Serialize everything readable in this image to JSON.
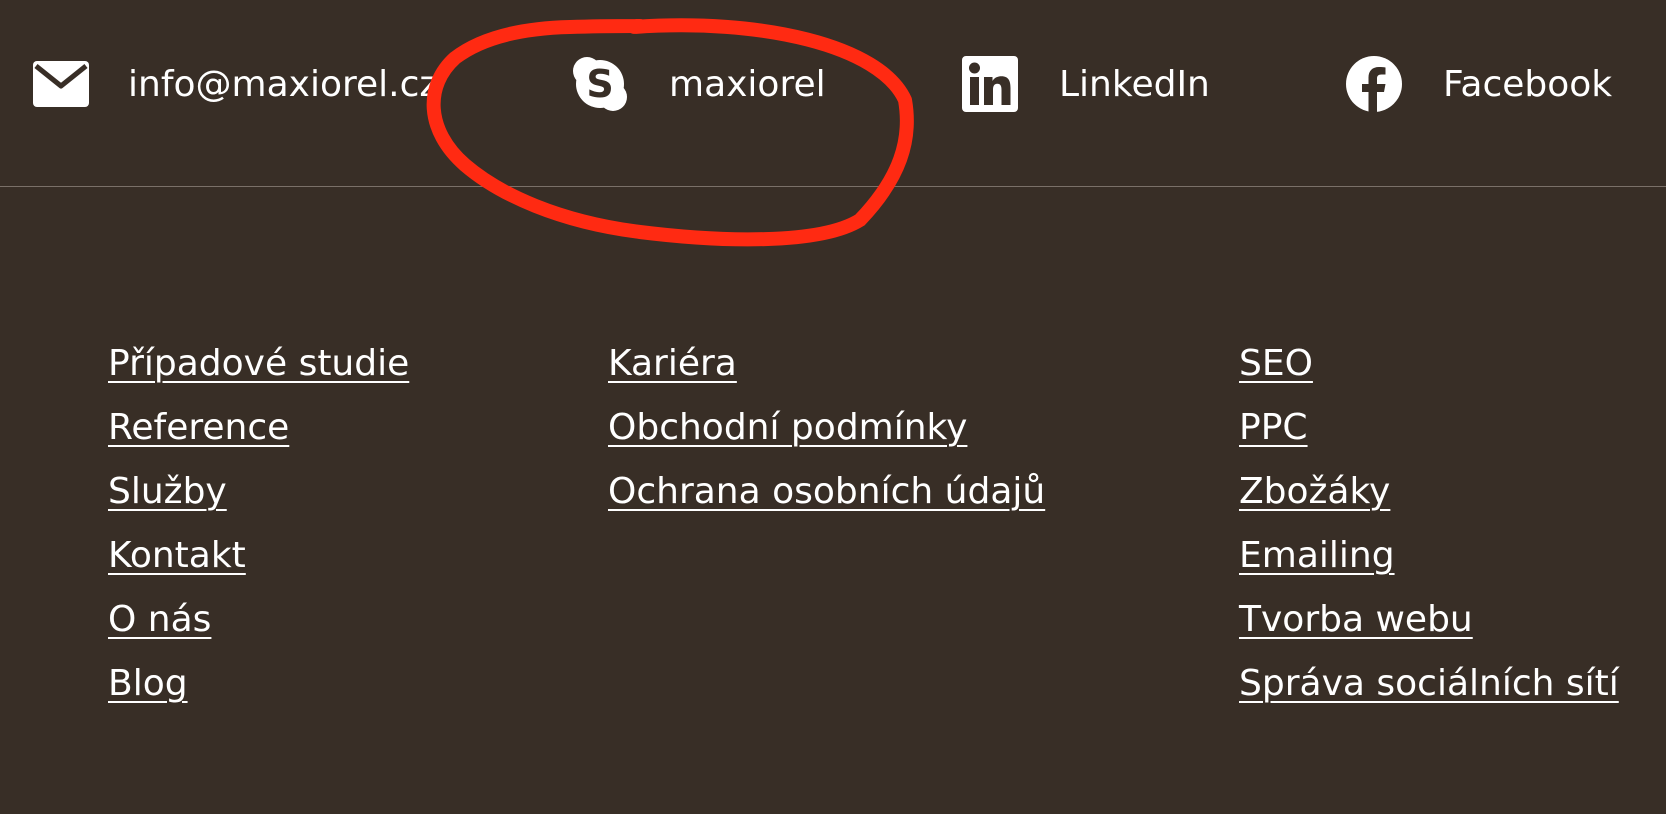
{
  "contacts": {
    "email": {
      "label": "info@maxiorel.cz",
      "icon": "envelope-icon"
    },
    "skype": {
      "label": "maxiorel",
      "icon": "skype-icon"
    },
    "linkedin": {
      "label": "LinkedIn",
      "icon": "linkedin-icon"
    },
    "facebook": {
      "label": "Facebook",
      "icon": "facebook-icon"
    }
  },
  "annotation": {
    "color": "#ff2a12",
    "shape": "hand-drawn-ellipse"
  },
  "footer": {
    "col1": [
      "Případové studie",
      "Reference",
      "Služby",
      "Kontakt",
      "O nás",
      "Blog"
    ],
    "col2": [
      "Kariéra",
      "Obchodní podmínky",
      "Ochrana osobních údajů"
    ],
    "col3": [
      "SEO",
      "PPC",
      "Zbožáky",
      "Emailing",
      "Tvorba webu",
      "Správa sociálních sítí"
    ]
  },
  "colors": {
    "background": "#382e26",
    "text": "#ffffff",
    "divider": "#7a7068"
  }
}
